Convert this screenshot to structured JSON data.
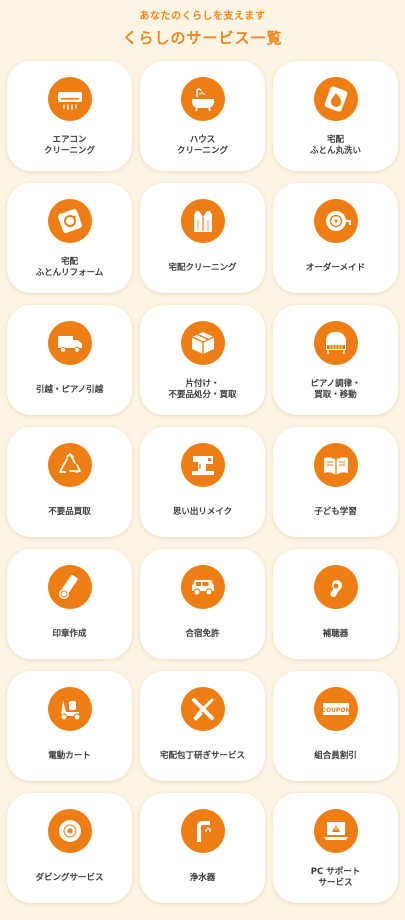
{
  "header": {
    "subtitle": "あなたのくらしを支えます",
    "title": "くらしのサービス一覧"
  },
  "theme": {
    "accent": "#ee7d13",
    "background": "#fdf5e4",
    "card": "#ffffff",
    "text": "#3a3a3a"
  },
  "services": [
    {
      "label": "エアコン\nクリーニング",
      "icon": "air-conditioner-icon"
    },
    {
      "label": "ハウス\nクリーニング",
      "icon": "bathtub-icon"
    },
    {
      "label": "宅配\nふとん丸洗い",
      "icon": "futon-wash-icon"
    },
    {
      "label": "宅配\nふとんリフォーム",
      "icon": "futon-reform-icon"
    },
    {
      "label": "宅配クリーニング",
      "icon": "shirt-icon"
    },
    {
      "label": "オーダーメイド",
      "icon": "tape-measure-icon"
    },
    {
      "label": "引越・ピアノ引越",
      "icon": "truck-icon"
    },
    {
      "label": "片付け・\n不要品処分・買取",
      "icon": "box-icon"
    },
    {
      "label": "ピアノ調律・\n買取・移動",
      "icon": "piano-icon"
    },
    {
      "label": "不要品買取",
      "icon": "recycle-icon"
    },
    {
      "label": "思い出リメイク",
      "icon": "sewing-machine-icon"
    },
    {
      "label": "子ども学習",
      "icon": "book-icon"
    },
    {
      "label": "印章作成",
      "icon": "stamp-icon"
    },
    {
      "label": "合宿免許",
      "icon": "car-icon"
    },
    {
      "label": "補聴器",
      "icon": "hearing-aid-icon"
    },
    {
      "label": "電動カート",
      "icon": "mobility-scooter-icon"
    },
    {
      "label": "宅配包丁研ぎサービス",
      "icon": "knife-sharpening-icon"
    },
    {
      "label": "組合員割引",
      "icon": "coupon-icon"
    },
    {
      "label": "ダビングサービス",
      "icon": "disc-icon"
    },
    {
      "label": "浄水器",
      "icon": "water-faucet-icon"
    },
    {
      "label": "PC サポート\nサービス",
      "icon": "pc-support-icon"
    }
  ]
}
